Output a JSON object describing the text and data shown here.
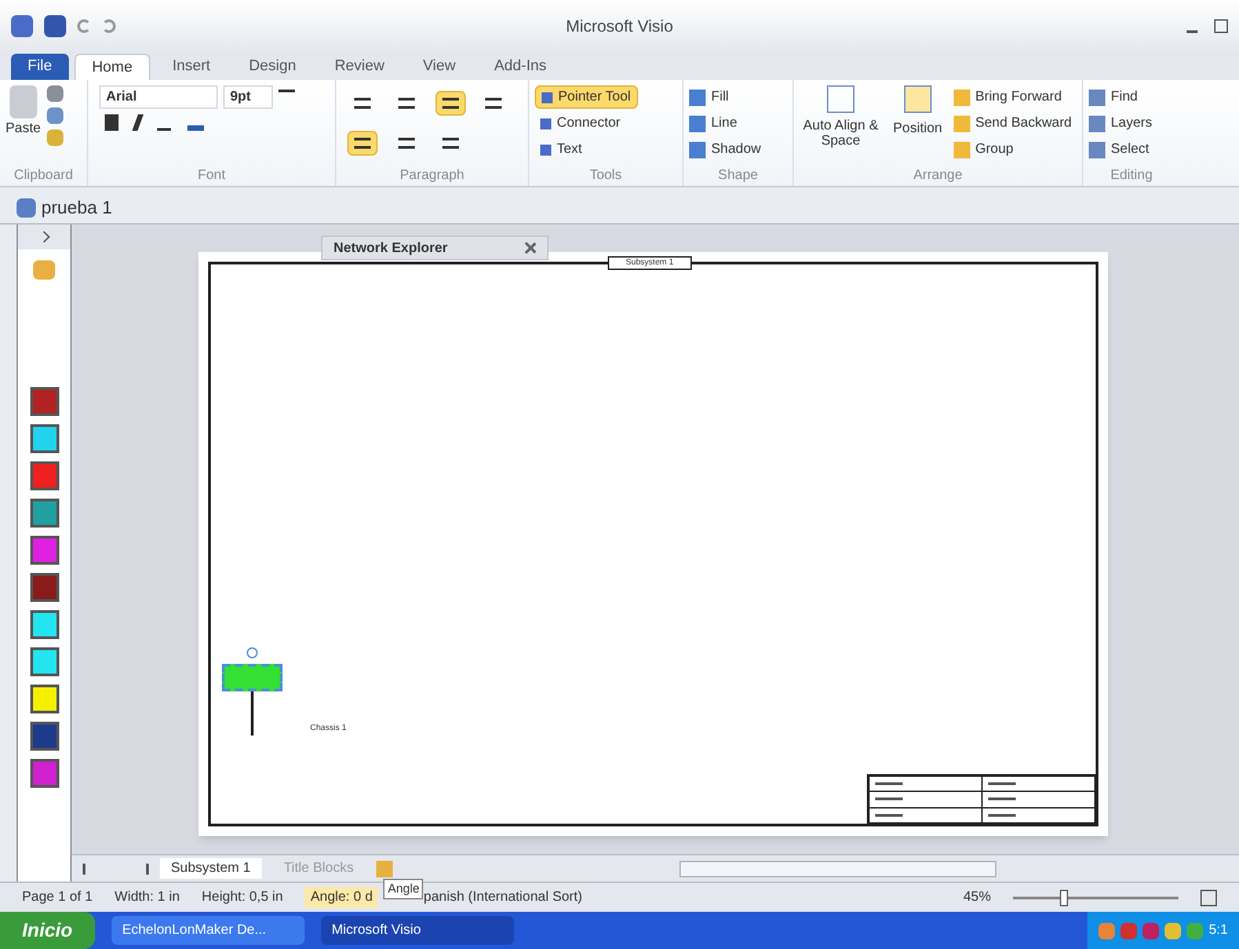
{
  "window": {
    "title": "Microsoft Visio"
  },
  "tabs": [
    {
      "label": "File",
      "kind": "file",
      "selected": false
    },
    {
      "label": "Home",
      "kind": "tab",
      "selected": true
    },
    {
      "label": "Insert",
      "kind": "tab",
      "selected": false
    },
    {
      "label": "Design",
      "kind": "tab",
      "selected": false
    },
    {
      "label": "Review",
      "kind": "tab",
      "selected": false
    },
    {
      "label": "View",
      "kind": "tab",
      "selected": false
    },
    {
      "label": "Add-Ins",
      "kind": "tab",
      "selected": false
    }
  ],
  "ribbon": {
    "paste": "Paste",
    "font": {
      "family": "Arial",
      "size": "9pt"
    },
    "paragraph_buttons": [
      {
        "selected": false
      },
      {
        "selected": false
      },
      {
        "selected": true
      },
      {
        "selected": false
      },
      {
        "selected": true
      },
      {
        "selected": false
      },
      {
        "selected": false
      }
    ],
    "tools": [
      {
        "label": "Pointer Tool",
        "selected": true
      },
      {
        "label": "Connector",
        "selected": false
      },
      {
        "label": "Text",
        "selected": false
      }
    ],
    "shape": [
      "Fill",
      "Line",
      "Shadow"
    ],
    "arrange": {
      "auto_align": "Auto Align & Space",
      "position": "Position",
      "items": [
        "Bring Forward",
        "Send Backward",
        "Group"
      ]
    },
    "editing": [
      "Find",
      "Layers",
      "Select"
    ],
    "group_labels": [
      "Clipboard",
      "Font",
      "Paragraph",
      "Tools",
      "Shape",
      "Arrange",
      "Editing"
    ]
  },
  "document": {
    "title": "prueba 1"
  },
  "stencil": [
    {
      "color": "#b22222"
    },
    {
      "color": "#22d3ee"
    },
    {
      "color": "#ef2020"
    },
    {
      "color": "#20a0a0"
    },
    {
      "color": "#e020e0"
    },
    {
      "color": "#8b1a1a"
    },
    {
      "color": "#22e5f0"
    },
    {
      "color": "#22e5f0"
    },
    {
      "color": "#f5f000"
    },
    {
      "color": "#1e3a8a"
    },
    {
      "color": "#d020d0"
    }
  ],
  "network_explorer": {
    "title": "Network Explorer"
  },
  "page": {
    "tab_label": "Subsystem 1",
    "shape_label": "Chassis 1"
  },
  "sheet_tabs": [
    {
      "label": "Subsystem 1",
      "selected": true
    },
    {
      "label": "Title Blocks",
      "selected": false
    }
  ],
  "status_bar": {
    "page": "Page 1 of 1",
    "width": "Width: 1 in",
    "height": "Height: 0,5 in",
    "angle": "Angle: 0 d",
    "tooltip": "Angle",
    "language": "panish (International Sort)",
    "zoom": "45%",
    "zoom_slider": {
      "level": 0.3
    }
  },
  "taskbar": {
    "start": "Inicio",
    "apps": [
      {
        "label": "EchelonLonMaker De...",
        "selected": false
      },
      {
        "label": "Microsoft Visio",
        "selected": true
      }
    ],
    "clock": "5:1"
  }
}
